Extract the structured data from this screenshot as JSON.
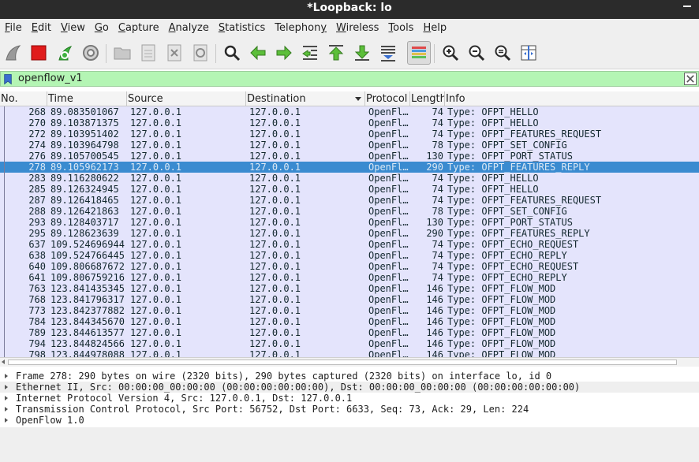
{
  "window": {
    "title": "*Loopback: lo"
  },
  "menu": [
    {
      "pre": "",
      "u": "F",
      "post": "ile"
    },
    {
      "pre": "",
      "u": "E",
      "post": "dit"
    },
    {
      "pre": "",
      "u": "V",
      "post": "iew"
    },
    {
      "pre": "",
      "u": "G",
      "post": "o"
    },
    {
      "pre": "",
      "u": "C",
      "post": "apture"
    },
    {
      "pre": "",
      "u": "A",
      "post": "nalyze"
    },
    {
      "pre": "",
      "u": "S",
      "post": "tatistics"
    },
    {
      "pre": "Telephon",
      "u": "y",
      "post": ""
    },
    {
      "pre": "",
      "u": "W",
      "post": "ireless"
    },
    {
      "pre": "",
      "u": "T",
      "post": "ools"
    },
    {
      "pre": "",
      "u": "H",
      "post": "elp"
    }
  ],
  "toolbar": {
    "icons": [
      "shark-fin-icon",
      "stop-icon",
      "restart-icon",
      "gear-icon",
      "open-folder-icon",
      "save-file-icon",
      "close-file-icon",
      "reload-file-icon",
      "search-icon",
      "arrow-left-icon",
      "arrow-right-icon",
      "goto-packet-icon",
      "arrow-up-icon",
      "arrow-down-icon",
      "autoscroll-icon",
      "colorize-icon",
      "zoom-in-icon",
      "zoom-out-icon",
      "zoom-normal-icon",
      "resize-columns-icon"
    ]
  },
  "filter": {
    "value": "openflow_v1"
  },
  "columns": [
    "No.",
    "Time",
    "Source",
    "Destination",
    "Protocol",
    "Length",
    "Info"
  ],
  "packets": [
    {
      "no": "268",
      "time": "89.083501067",
      "src": "127.0.0.1",
      "dst": "127.0.0.1",
      "proto": "OpenFl…",
      "len": "74",
      "info": "Type: OFPT_HELLO"
    },
    {
      "no": "270",
      "time": "89.103871375",
      "src": "127.0.0.1",
      "dst": "127.0.0.1",
      "proto": "OpenFl…",
      "len": "74",
      "info": "Type: OFPT_HELLO"
    },
    {
      "no": "272",
      "time": "89.103951402",
      "src": "127.0.0.1",
      "dst": "127.0.0.1",
      "proto": "OpenFl…",
      "len": "74",
      "info": "Type: OFPT_FEATURES_REQUEST"
    },
    {
      "no": "274",
      "time": "89.103964798",
      "src": "127.0.0.1",
      "dst": "127.0.0.1",
      "proto": "OpenFl…",
      "len": "78",
      "info": "Type: OFPT_SET_CONFIG"
    },
    {
      "no": "276",
      "time": "89.105700545",
      "src": "127.0.0.1",
      "dst": "127.0.0.1",
      "proto": "OpenFl…",
      "len": "130",
      "info": "Type: OFPT_PORT_STATUS"
    },
    {
      "no": "278",
      "time": "89.105962173",
      "src": "127.0.0.1",
      "dst": "127.0.0.1",
      "proto": "OpenFl…",
      "len": "290",
      "info": "Type: OFPT_FEATURES_REPLY",
      "selected": true
    },
    {
      "no": "283",
      "time": "89.116280622",
      "src": "127.0.0.1",
      "dst": "127.0.0.1",
      "proto": "OpenFl…",
      "len": "74",
      "info": "Type: OFPT_HELLO"
    },
    {
      "no": "285",
      "time": "89.126324945",
      "src": "127.0.0.1",
      "dst": "127.0.0.1",
      "proto": "OpenFl…",
      "len": "74",
      "info": "Type: OFPT_HELLO"
    },
    {
      "no": "287",
      "time": "89.126418465",
      "src": "127.0.0.1",
      "dst": "127.0.0.1",
      "proto": "OpenFl…",
      "len": "74",
      "info": "Type: OFPT_FEATURES_REQUEST"
    },
    {
      "no": "288",
      "time": "89.126421863",
      "src": "127.0.0.1",
      "dst": "127.0.0.1",
      "proto": "OpenFl…",
      "len": "78",
      "info": "Type: OFPT_SET_CONFIG"
    },
    {
      "no": "293",
      "time": "89.128403717",
      "src": "127.0.0.1",
      "dst": "127.0.0.1",
      "proto": "OpenFl…",
      "len": "130",
      "info": "Type: OFPT_PORT_STATUS"
    },
    {
      "no": "295",
      "time": "89.128623639",
      "src": "127.0.0.1",
      "dst": "127.0.0.1",
      "proto": "OpenFl…",
      "len": "290",
      "info": "Type: OFPT_FEATURES_REPLY"
    },
    {
      "no": "637",
      "time": "109.524696944",
      "src": "127.0.0.1",
      "dst": "127.0.0.1",
      "proto": "OpenFl…",
      "len": "74",
      "info": "Type: OFPT_ECHO_REQUEST"
    },
    {
      "no": "638",
      "time": "109.524766445",
      "src": "127.0.0.1",
      "dst": "127.0.0.1",
      "proto": "OpenFl…",
      "len": "74",
      "info": "Type: OFPT_ECHO_REPLY"
    },
    {
      "no": "640",
      "time": "109.806687672",
      "src": "127.0.0.1",
      "dst": "127.0.0.1",
      "proto": "OpenFl…",
      "len": "74",
      "info": "Type: OFPT_ECHO_REQUEST"
    },
    {
      "no": "641",
      "time": "109.806759216",
      "src": "127.0.0.1",
      "dst": "127.0.0.1",
      "proto": "OpenFl…",
      "len": "74",
      "info": "Type: OFPT_ECHO_REPLY"
    },
    {
      "no": "763",
      "time": "123.841435345",
      "src": "127.0.0.1",
      "dst": "127.0.0.1",
      "proto": "OpenFl…",
      "len": "146",
      "info": "Type: OFPT_FLOW_MOD"
    },
    {
      "no": "768",
      "time": "123.841796317",
      "src": "127.0.0.1",
      "dst": "127.0.0.1",
      "proto": "OpenFl…",
      "len": "146",
      "info": "Type: OFPT_FLOW_MOD"
    },
    {
      "no": "773",
      "time": "123.842377882",
      "src": "127.0.0.1",
      "dst": "127.0.0.1",
      "proto": "OpenFl…",
      "len": "146",
      "info": "Type: OFPT_FLOW_MOD"
    },
    {
      "no": "784",
      "time": "123.844345670",
      "src": "127.0.0.1",
      "dst": "127.0.0.1",
      "proto": "OpenFl…",
      "len": "146",
      "info": "Type: OFPT_FLOW_MOD"
    },
    {
      "no": "789",
      "time": "123.844613577",
      "src": "127.0.0.1",
      "dst": "127.0.0.1",
      "proto": "OpenFl…",
      "len": "146",
      "info": "Type: OFPT_FLOW_MOD"
    },
    {
      "no": "794",
      "time": "123.844824566",
      "src": "127.0.0.1",
      "dst": "127.0.0.1",
      "proto": "OpenFl…",
      "len": "146",
      "info": "Type: OFPT_FLOW_MOD"
    },
    {
      "no": "798",
      "time": "123.844978088",
      "src": "127.0.0.1",
      "dst": "127.0.0.1",
      "proto": "OpenFl…",
      "len": "146",
      "info": "Type: OFPT_FLOW_MOD"
    }
  ],
  "details": [
    "Frame 278: 290 bytes on wire (2320 bits), 290 bytes captured (2320 bits) on interface lo, id 0",
    "Ethernet II, Src: 00:00:00_00:00:00 (00:00:00:00:00:00), Dst: 00:00:00_00:00:00 (00:00:00:00:00:00)",
    "Internet Protocol Version 4, Src: 127.0.0.1, Dst: 127.0.0.1",
    "Transmission Control Protocol, Src Port: 56752, Dst Port: 6633, Seq: 73, Ack: 29, Len: 224",
    "OpenFlow 1.0"
  ],
  "colors": {
    "packet_row_bg": "#e4e4fc",
    "selected_row_bg": "#3a8bd0",
    "filter_bg": "#b4f5b4",
    "titlebar_bg": "#2b2b2b"
  }
}
